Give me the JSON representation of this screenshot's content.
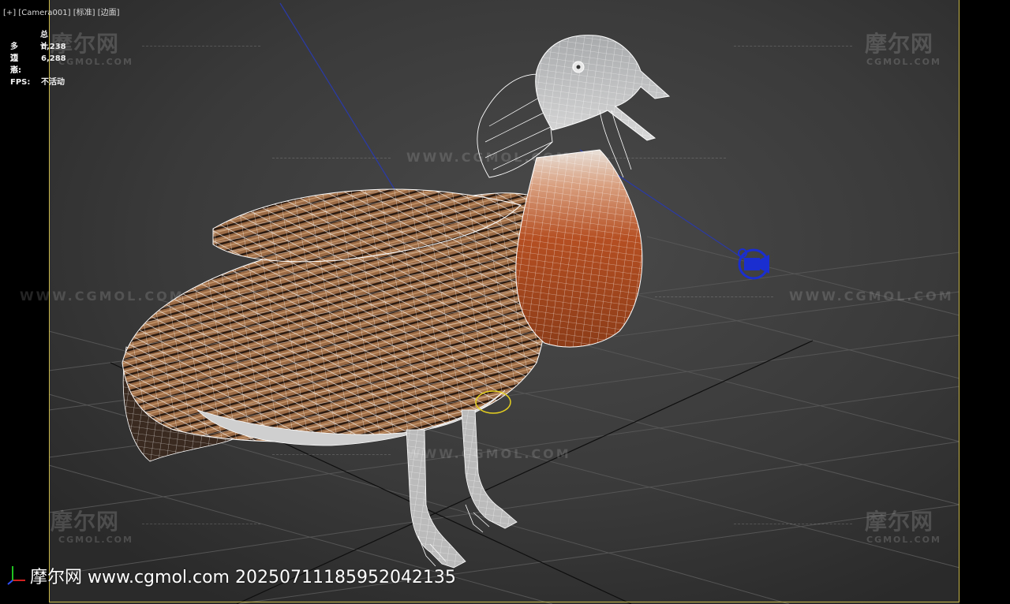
{
  "viewport": {
    "label_parts": [
      "[+]",
      "[Camera001]",
      "[标准]",
      "[边面]"
    ]
  },
  "stats": {
    "header": "总计",
    "polygons_label": "多边形:",
    "polygons_value": "6,238",
    "vertices_label": "顶点:",
    "vertices_value": "6,288",
    "fps_label": "FPS:",
    "fps_value": "不活动"
  },
  "watermarks": {
    "brand": "摩尔网",
    "small": "CGMOL.COM",
    "url": "WWW.CGMOL.COM"
  },
  "footer": {
    "text": "摩尔网 www.cgmol.com 20250711185952042135"
  },
  "colors": {
    "frame": "#c9b84a",
    "background": "#3c3c3c",
    "grid": "#4e4e4e",
    "grid_axis": "#0a0a0a",
    "wire": "#ffffff",
    "feather": "#8a5a38",
    "breast": "#b5542a",
    "camera_target": "#2030c0"
  },
  "icons": {
    "axis": "axis-tripod-icon",
    "camera_target": "camera-target-icon"
  }
}
